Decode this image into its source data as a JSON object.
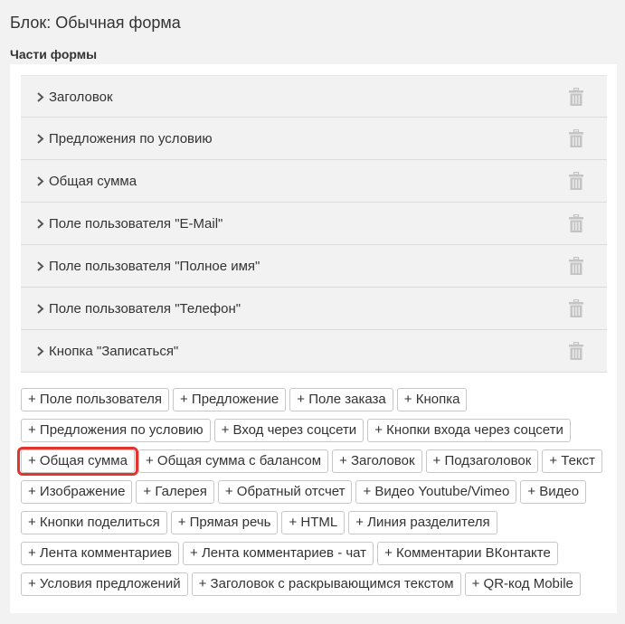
{
  "block": {
    "title": "Блок: Обычная форма",
    "section_label": "Части формы"
  },
  "parts": [
    {
      "label": "Заголовок"
    },
    {
      "label": "Предложения по условию"
    },
    {
      "label": "Общая сумма"
    },
    {
      "label": "Поле пользователя \"E-Mail\""
    },
    {
      "label": "Поле пользователя \"Полное имя\""
    },
    {
      "label": "Поле пользователя \"Телефон\""
    },
    {
      "label": "Кнопка \"Записаться\""
    }
  ],
  "add_buttons": {
    "rows": [
      [
        "+ Поле пользователя",
        "+ Предложение",
        "+ Поле заказа",
        "+ Кнопка"
      ],
      [
        "+ Предложения по условию",
        "+ Вход через соцсети",
        "+ Кнопки входа через соцсети"
      ],
      [
        "+ Общая сумма",
        "+ Общая сумма с балансом",
        "+ Заголовок",
        "+ Подзаголовок",
        "+ Текст"
      ],
      [
        "+ Изображение",
        "+ Галерея",
        "+ Обратный отсчет",
        "+ Видео Youtube/Vimeo",
        "+ Видео"
      ],
      [
        "+ Кнопки поделиться",
        "+ Прямая речь",
        "+ HTML",
        "+ Линия разделителя"
      ],
      [
        "+ Лента комментариев",
        "+ Лента комментариев - чат",
        "+ Комментарии ВКонтакте"
      ],
      [
        "+ Условия предложений",
        "+ Заголовок с раскрывающимся текстом",
        "+ QR-код Mobile"
      ]
    ],
    "highlighted": "+ Общая сумма"
  },
  "icons": {
    "row_expand": "chevron-right-icon",
    "row_delete": "trash-icon"
  },
  "colors": {
    "highlight": "#e0342f",
    "row_background": "#f2f2f2",
    "icon_gray": "#c4c4c4"
  }
}
